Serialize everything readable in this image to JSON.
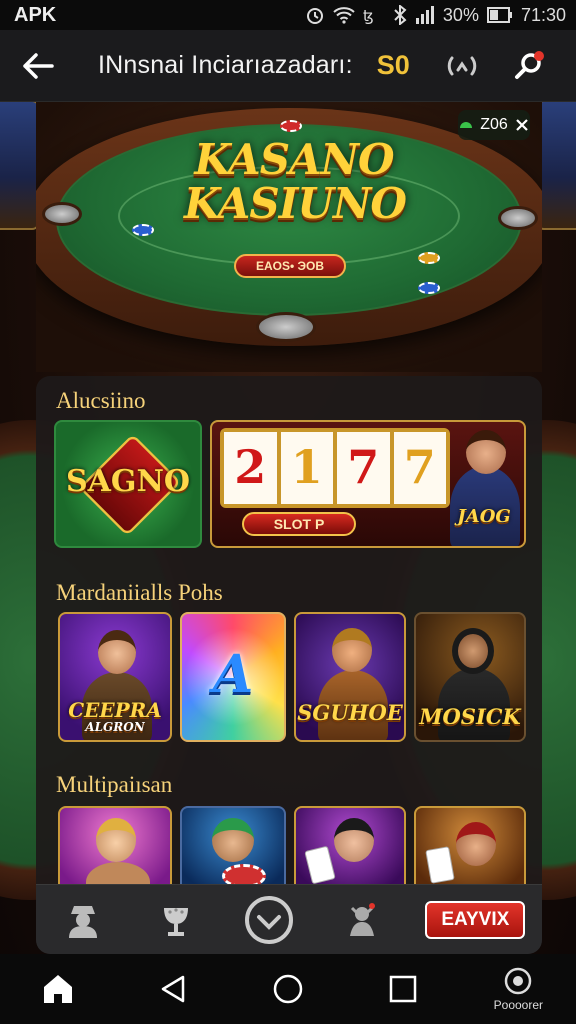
{
  "status_bar": {
    "carrier": "APK",
    "battery": "30%",
    "time": "71:30",
    "icons": [
      "alarm-icon",
      "wifi-icon",
      "signal-icon",
      "bluetooth-icon",
      "battery-icon"
    ]
  },
  "header": {
    "title": "INnsnai Inciarıazadarı:",
    "coins": "S0",
    "icons": [
      "back-arrow-icon",
      "refresh-icon",
      "search-icon"
    ]
  },
  "hero": {
    "logo_line1": "KASANO",
    "logo_line2": "KASIUNO",
    "tag": "ЕAOS• ЭOB",
    "badge": "Z06"
  },
  "sections": [
    {
      "title": "Alucsiino",
      "tiles": [
        {
          "caption": "SAGNO"
        },
        {
          "caption": "SLOT P",
          "reels": [
            "2",
            "1",
            "7",
            "7"
          ],
          "side_caption": "JAOG"
        }
      ]
    },
    {
      "title": "Mardaniialls Pohs",
      "tiles": [
        {
          "caption": "CEEPRA",
          "sub": "ALGRON"
        },
        {
          "caption": "A"
        },
        {
          "caption": "SGUHOE"
        },
        {
          "caption": "MOSICK"
        }
      ]
    },
    {
      "title": "Multipaiısan",
      "tiles": [
        {
          "caption": ""
        },
        {
          "caption": ""
        },
        {
          "caption": ""
        },
        {
          "caption": ""
        }
      ]
    }
  ],
  "panel_tabs": {
    "items": [
      "profile-icon",
      "trophy-icon",
      "check-circle-icon",
      "gift-icon"
    ],
    "cta": "EAYVIX"
  },
  "system_nav": {
    "recent_label": "Poooorer"
  },
  "colors": {
    "accent_gold": "#f6d27a",
    "coin_gold": "#f0c23a",
    "felt_green": "#1f6a33",
    "cta_red": "#e3342a"
  }
}
